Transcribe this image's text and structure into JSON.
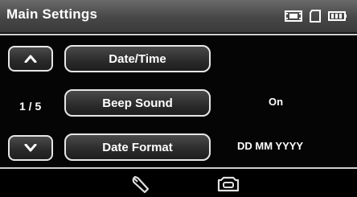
{
  "header": {
    "title": "Main Settings",
    "icons": [
      "film-mode-icon",
      "sd-card-icon",
      "battery-icon"
    ]
  },
  "pagination": {
    "label": "1 / 5"
  },
  "menu": {
    "items": [
      {
        "label": "Date/Time",
        "value": ""
      },
      {
        "label": "Beep Sound",
        "value": "On"
      },
      {
        "label": "Date Format",
        "value": "DD MM YYYY"
      }
    ]
  },
  "footer": {
    "icons": [
      "wrench-icon",
      "camera-mode-icon"
    ]
  },
  "colors": {
    "background": "#050505",
    "header": "#4a4a4a",
    "button_border": "#e6e6e6",
    "text": "#ffffff"
  }
}
